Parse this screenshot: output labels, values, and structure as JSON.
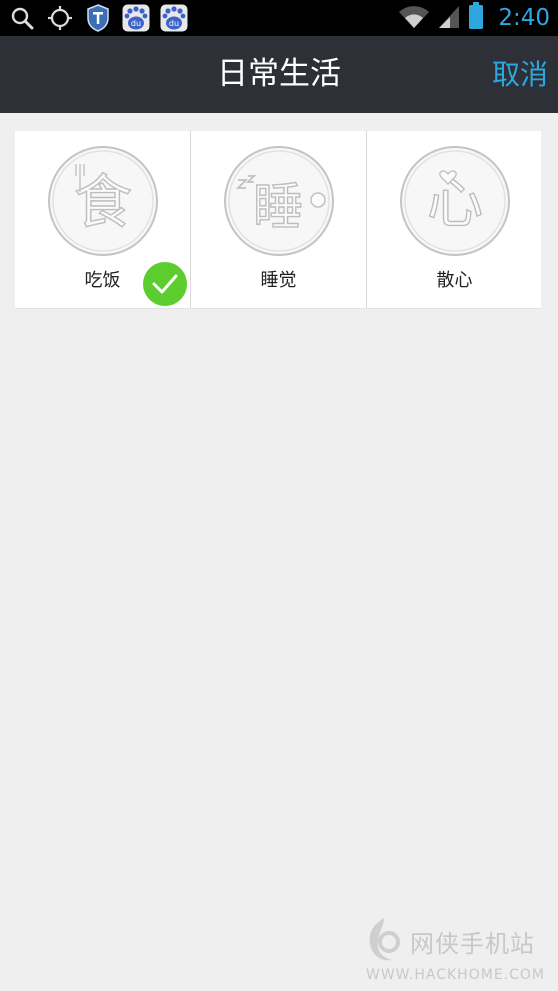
{
  "status_bar": {
    "time": "2:40",
    "left_icons": [
      "search-icon",
      "gps-icon",
      "shield-icon",
      "baidu-icon",
      "baidu-icon"
    ],
    "right_icons": [
      "wifi-icon",
      "signal-icon",
      "battery-icon"
    ]
  },
  "header": {
    "title": "日常生活",
    "cancel_label": "取消"
  },
  "categories": [
    {
      "label": "吃饭",
      "medal_char": "食",
      "selected": true
    },
    {
      "label": "睡觉",
      "medal_char": "睡",
      "selected": false
    },
    {
      "label": "散心",
      "medal_char": "心",
      "selected": false
    }
  ],
  "watermark": {
    "text": "网侠手机站",
    "url": "WWW.HACKHOME.COM"
  },
  "colors": {
    "title_bar_bg": "#2d3037",
    "accent": "#2ea6de",
    "check_green": "#5ccd2e",
    "page_bg": "#efefef"
  }
}
